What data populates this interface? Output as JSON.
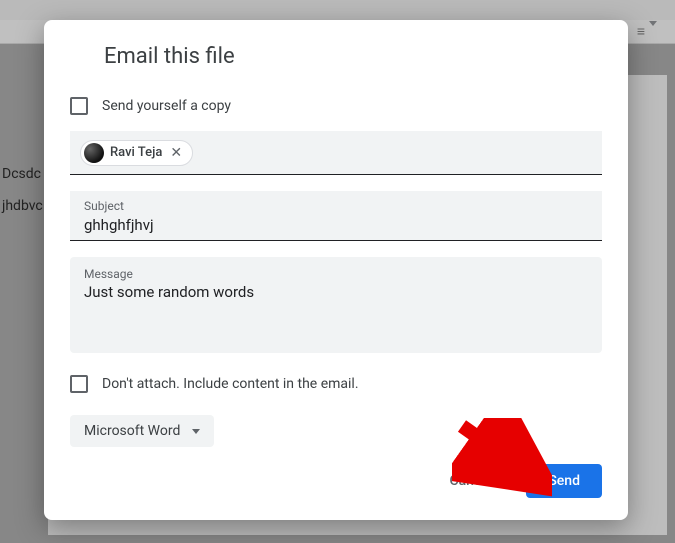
{
  "dialog": {
    "title": "Email this file",
    "send_copy_label": "Send yourself a copy",
    "recipient": {
      "name": "Ravi Teja"
    },
    "subject_label": "Subject",
    "subject_value": "ghhghfjhvj",
    "message_label": "Message",
    "message_value": "Just some random words",
    "dont_attach_label": "Don't attach. Include content in the email.",
    "format_value": "Microsoft Word",
    "cancel_label": "Cancel",
    "send_label": "Send"
  },
  "background": {
    "text1": "Dcsdc",
    "text2": "jhdbvc",
    "indent_icon": "≡"
  }
}
